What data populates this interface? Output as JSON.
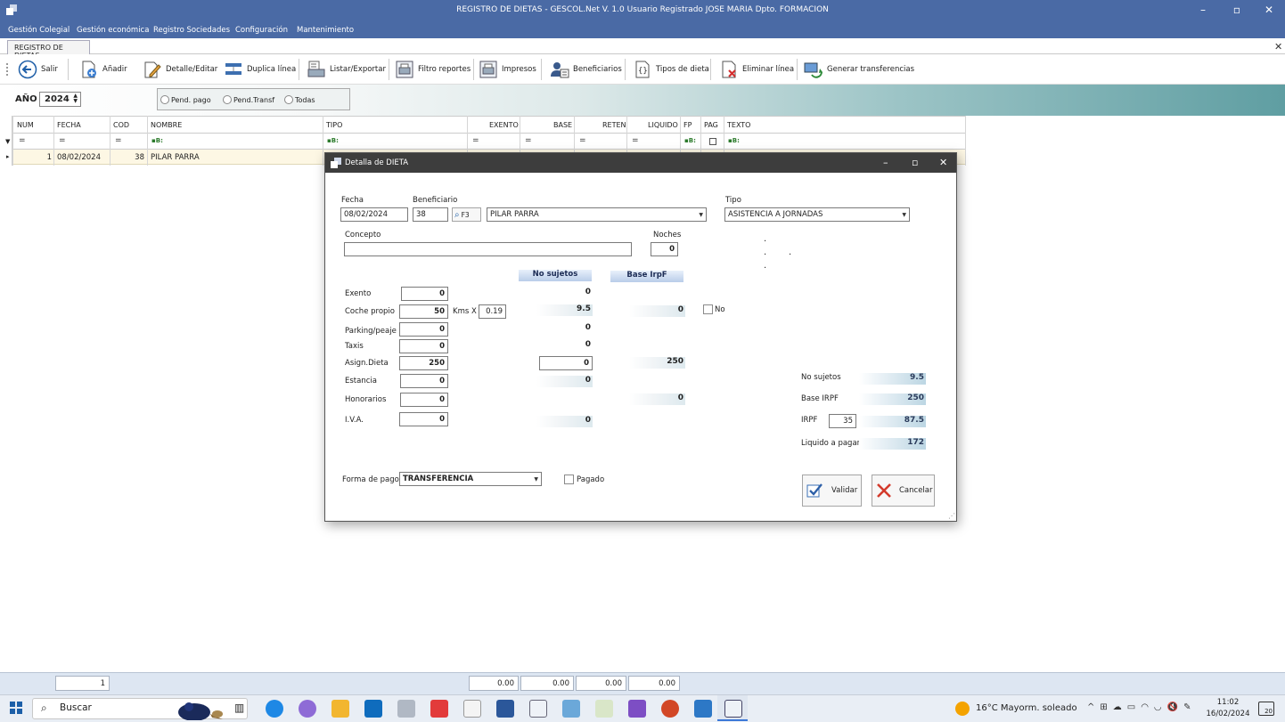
{
  "window": {
    "title": "REGISTRO DE DIETAS - GESCOL.Net V. 1.0  Usuario Registrado JOSE MARIA  Dpto. FORMACION"
  },
  "menu": [
    "Gestión Colegial",
    "Gestión económica",
    "Registro Sociedades",
    "Configuración",
    "Mantenimiento"
  ],
  "tab": {
    "label": "REGISTRO DE DIETAS"
  },
  "toolbar": {
    "salir": "Salir",
    "anadir": "Añadir",
    "detalle": "Detalle/Editar",
    "duplica": "Duplica línea",
    "listar": "Listar/Exportar",
    "filtro": "Filtro reportes",
    "impresos": "Impresos",
    "beneficiarios": "Beneficiarios",
    "tipos": "Tipos de dieta",
    "eliminar": "Eliminar línea",
    "generar": "Generar transferencias"
  },
  "year": {
    "label": "AÑO",
    "value": "2024"
  },
  "filter_options": [
    "Pend. pago",
    "Pend.Transf",
    "Todas"
  ],
  "grid": {
    "columns": [
      "NUM",
      "FECHA",
      "COD",
      "NOMBRE",
      "TIPO",
      "EXENTO",
      "BASE",
      "RETEN",
      "LIQUIDO",
      "FP",
      "PAG",
      "TEXTO"
    ],
    "row": {
      "num": "1",
      "fecha": "08/02/2024",
      "cod": "38",
      "nombre": "PILAR PARRA"
    }
  },
  "totals": {
    "count": "1",
    "exento": "0.00",
    "base": "0.00",
    "reten": "0.00",
    "liquido": "0.00"
  },
  "dialog": {
    "title": "Detalla de DIETA",
    "fecha_label": "Fecha",
    "fecha": "08/02/2024",
    "beneficiario_label": "Beneficiario",
    "beneficiario_code": "38",
    "lookup_key": "F3",
    "beneficiario_name": "PILAR PARRA",
    "tipo_label": "Tipo",
    "tipo": "ASISTENCIA A JORNADAS",
    "concepto_label": "Concepto",
    "concepto": "",
    "noches_label": "Noches",
    "noches": "0",
    "col_no_sujetos": "No sujetos",
    "col_base_irpf": "Base IrpF",
    "rows": {
      "exento": {
        "label": "Exento",
        "value": "0",
        "ns": "0"
      },
      "coche": {
        "label": "Coche propio",
        "value": "50",
        "kms_label": "Kms X",
        "kms_rate": "0.19",
        "ns": "9.5",
        "base": "0",
        "no_label": "No"
      },
      "parking": {
        "label": "Parking/peaje",
        "value": "0",
        "ns": "0"
      },
      "taxis": {
        "label": "Taxis",
        "value": "0",
        "ns": "0"
      },
      "asign": {
        "label": "Asign.Dieta",
        "value": "250",
        "ns": "0",
        "base": "250"
      },
      "estancia": {
        "label": "Estancia",
        "value": "0",
        "ns": "0"
      },
      "honorarios": {
        "label": "Honorarios",
        "value": "0",
        "base": "0"
      },
      "iva": {
        "label": "I.V.A.",
        "value": "0",
        "ns": "0"
      }
    },
    "summary": {
      "no_sujetos_label": "No sujetos",
      "no_sujetos": "9.5",
      "base_irpf_label": "Base IRPF",
      "base_irpf": "250",
      "irpf_label": "IRPF",
      "irpf_pct": "35",
      "irpf": "87.5",
      "liquido_label": "Liquido a pagar",
      "liquido": "172"
    },
    "forma_pago_label": "Forma de pago",
    "forma_pago": "TRANSFERENCIA",
    "pagado_label": "Pagado",
    "validar": "Validar",
    "cancelar": "Cancelar"
  },
  "taskbar": {
    "search": "Buscar",
    "weather": "16°C  Mayorm. soleado",
    "time": "11:02",
    "date": "16/02/2024",
    "notifications": "20"
  }
}
